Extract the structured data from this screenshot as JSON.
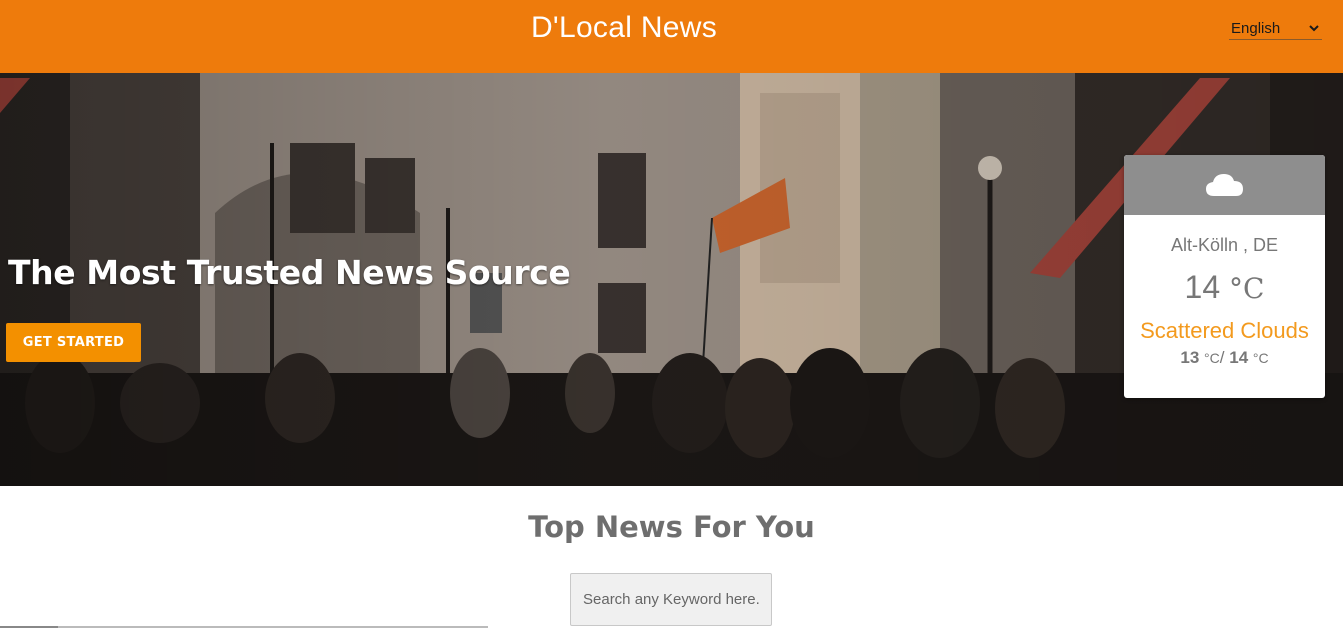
{
  "header": {
    "brand": "D'Local News",
    "language": {
      "selected": "English",
      "icon": "chevron-down-icon"
    },
    "background_color": "#ee7b0c"
  },
  "hero": {
    "title": "The Most Trusted News Source",
    "cta_label": "GET STARTED",
    "accent_color": "#f39000"
  },
  "weather": {
    "icon": "cloud-icon",
    "location": "Alt-Kölln , DE",
    "temperature": "14",
    "unit": "°C",
    "description": "Scattered Clouds",
    "min_temp": "13",
    "max_temp": "14",
    "range_separator": "/",
    "description_color": "#f39a1e"
  },
  "main": {
    "section_title": "Top News For You",
    "search": {
      "placeholder": "Search any Keyword here..",
      "value": ""
    }
  }
}
